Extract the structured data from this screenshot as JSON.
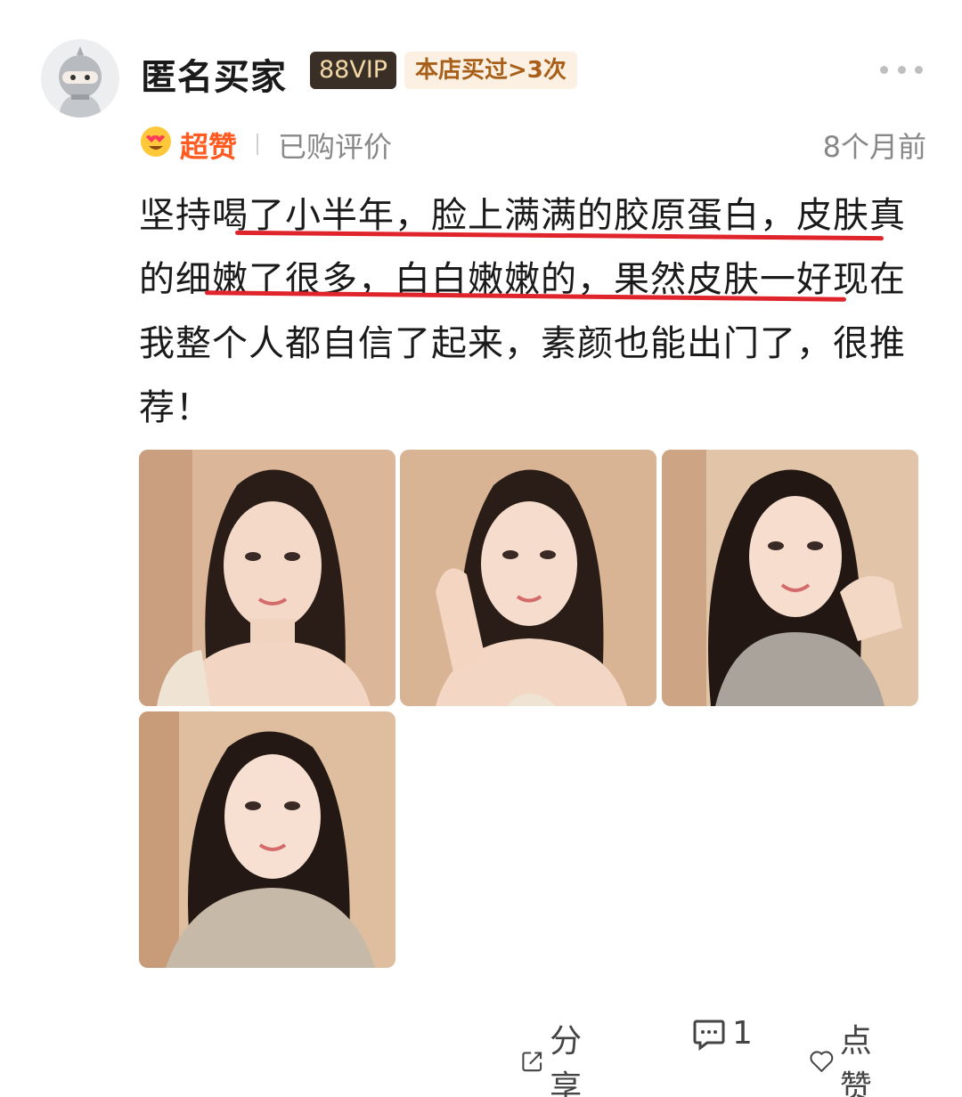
{
  "user": {
    "name": "匿名买家",
    "vip_badge": "88VIP",
    "purchase_badge": "本店买过>3次",
    "avatar_icon": "ninja-avatar-icon"
  },
  "meta": {
    "rating_icon": "heart-eyes-emoji-icon",
    "rating": "超赞",
    "purchased": "已购评价",
    "time": "8个月前"
  },
  "review": {
    "text": "坚持喝了小半年，脸上满满的胶原蛋白，皮肤真的细嫩了很多，白白嫩嫩的，果然皮肤一好现在我整个人都自信了起来，素颜也能出门了，很推荐！"
  },
  "photos": [
    "photo-1",
    "photo-2",
    "photo-3",
    "photo-4"
  ],
  "actions": {
    "share": "分享",
    "comment_count": "1",
    "like": "点赞"
  },
  "colors": {
    "accent": "#ff5a1f",
    "underline": "#e0242c",
    "vip_bg": "#3a2f27",
    "vip_fg": "#f3d7a6",
    "buy_bg": "#fbf0e1",
    "buy_fg": "#a85f19"
  }
}
